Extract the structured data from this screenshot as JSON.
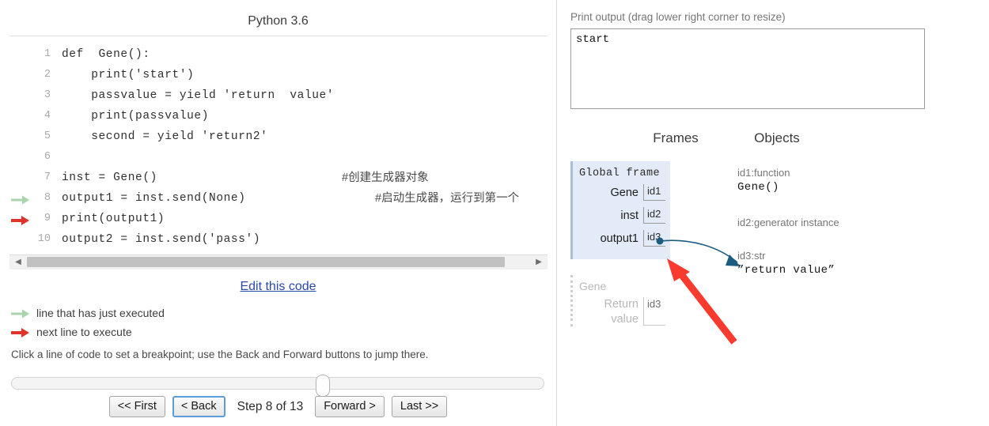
{
  "left": {
    "lang_title": "Python 3.6",
    "code_lines": [
      {
        "n": "1",
        "text": "def  Gene():",
        "comment": "",
        "marker": "none"
      },
      {
        "n": "2",
        "text": "    print('start')",
        "comment": "",
        "marker": "none"
      },
      {
        "n": "3",
        "text": "    passvalue = yield 'return  value'",
        "comment": "",
        "marker": "none"
      },
      {
        "n": "4",
        "text": "    print(passvalue)",
        "comment": "",
        "marker": "none"
      },
      {
        "n": "5",
        "text": "    second = yield 'return2'",
        "comment": "",
        "marker": "none"
      },
      {
        "n": "6",
        "text": "",
        "comment": "",
        "marker": "none"
      },
      {
        "n": "7",
        "text": "inst = Gene()",
        "comment": "#创建生成器对象",
        "marker": "none"
      },
      {
        "n": "8",
        "text": "output1 = inst.send(None)",
        "comment": "#启动生成器，运行到第一个",
        "marker": "executed"
      },
      {
        "n": "9",
        "text": "print(output1)",
        "comment": "",
        "marker": "next"
      },
      {
        "n": "10",
        "text": "output2 = inst.send('pass')",
        "comment": "",
        "marker": "none"
      }
    ],
    "edit_link": "Edit this code",
    "legend_executed": "line that has just executed",
    "legend_next": "next line to execute",
    "breakpoint_hint": "Click a line of code to set a breakpoint; use the Back and Forward buttons to jump there.",
    "controls": {
      "first": "<< First",
      "back": "< Back",
      "step_label": "Step 8 of 13",
      "forward": "Forward >",
      "last": "Last >>",
      "current_step": 8,
      "total_steps": 13
    }
  },
  "right": {
    "print_output_label": "Print output (drag lower right corner to resize)",
    "print_output_value": "start",
    "frames_heading": "Frames",
    "objects_heading": "Objects",
    "global_frame": {
      "title": "Global frame",
      "vars": [
        {
          "name": "Gene",
          "value": "id1"
        },
        {
          "name": "inst",
          "value": "id2"
        },
        {
          "name": "output1",
          "value": "id3"
        }
      ]
    },
    "gene_frame": {
      "title": "Gene",
      "vars": [
        {
          "name": "Return value",
          "value": "id3"
        }
      ]
    },
    "objects": [
      {
        "label": "id1:function",
        "value": "Gene()"
      },
      {
        "label": "id2:generator instance",
        "value": ""
      },
      {
        "label": "id3:str",
        "value": "”return  value”"
      }
    ]
  },
  "colors": {
    "executed_arrow": "#a8d5a9",
    "next_arrow": "#e0342a",
    "frame_bg": "#e2ebf7",
    "pointer_arrow": "#1b5c80",
    "annotation_arrow": "#f93a2e",
    "link": "#2a48a8"
  }
}
